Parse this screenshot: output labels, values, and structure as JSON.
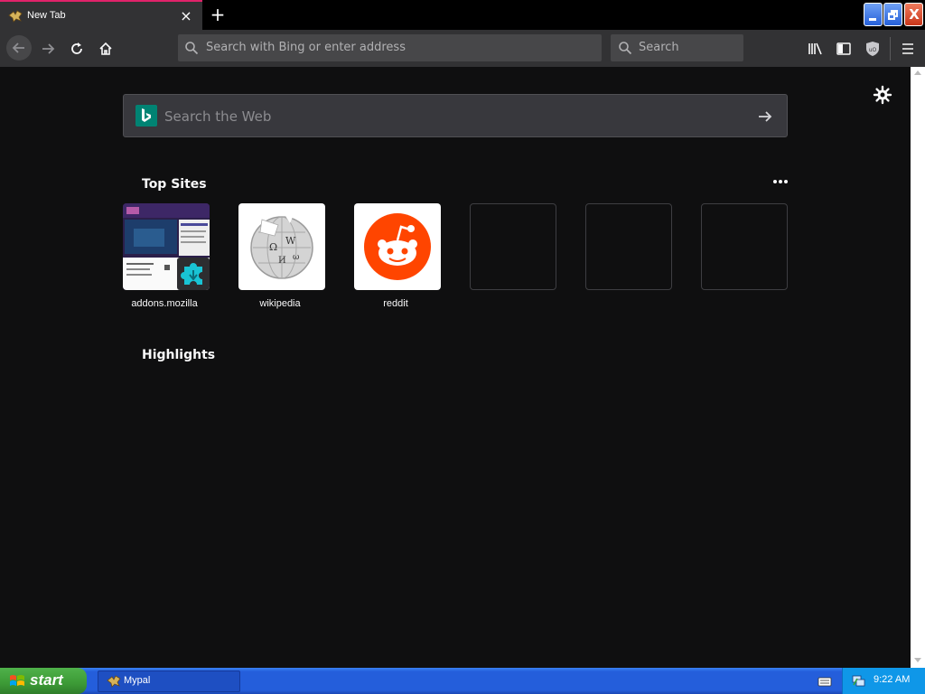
{
  "tab": {
    "title": "New Tab",
    "close_glyph": "×",
    "new_tab_glyph": "+"
  },
  "window_buttons": {
    "close_glyph": "X"
  },
  "navbar": {
    "url_placeholder": "Search with Bing or enter address",
    "search_placeholder": "Search"
  },
  "newtab": {
    "web_search_placeholder": "Search the Web",
    "top_sites_title": "Top Sites",
    "highlights_title": "Highlights",
    "top_sites": [
      {
        "label": "addons.mozilla"
      },
      {
        "label": "wikipedia"
      },
      {
        "label": "reddit"
      }
    ]
  },
  "taskbar": {
    "start_label": "start",
    "task_label": "Mypal",
    "clock": "9:22 AM"
  },
  "colors": {
    "tab_accent": "#e0226a",
    "toolbar": "#323234",
    "content_bg": "#0f0f10",
    "bing": "#008373",
    "reddit": "#ff4500",
    "taskbar_blue": "#245edb",
    "start_green": "#3c9a36"
  }
}
